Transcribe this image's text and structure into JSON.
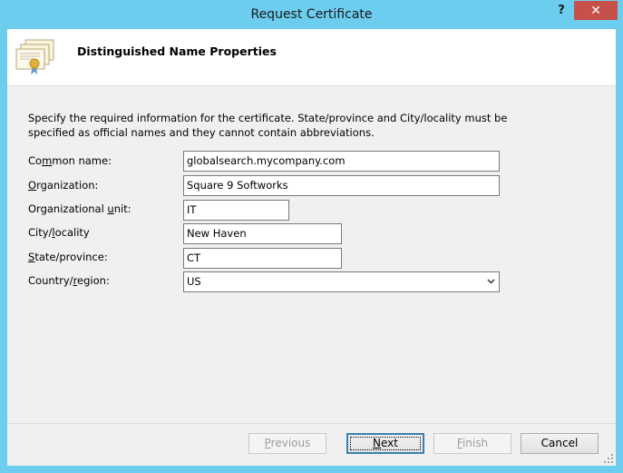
{
  "window": {
    "title": "Request Certificate"
  },
  "titlebar": {
    "help_glyph": "?",
    "close_glyph": "✕"
  },
  "header": {
    "title": "Distinguished Name Properties",
    "icon": "certificate-icon"
  },
  "instructions": "Specify the required information for the certificate. State/province and City/locality must be specified as official names and they cannot contain abbreviations.",
  "form": {
    "common_name": {
      "label_pre": "Co",
      "label_acc": "m",
      "label_post": "mon name:",
      "value": "globalsearch.mycompany.com"
    },
    "organization": {
      "label_pre": "",
      "label_acc": "O",
      "label_post": "rganization:",
      "value": "Square 9 Softworks"
    },
    "org_unit": {
      "label_pre": "Organizational ",
      "label_acc": "u",
      "label_post": "nit:",
      "value": "IT"
    },
    "city": {
      "label_pre": "City/",
      "label_acc": "l",
      "label_post": "ocality",
      "value": "New Haven"
    },
    "state": {
      "label_pre": "",
      "label_acc": "S",
      "label_post": "tate/province:",
      "value": "CT"
    },
    "country": {
      "label_pre": "Country/",
      "label_acc": "r",
      "label_post": "egion:",
      "value": "US"
    }
  },
  "buttons": {
    "previous": {
      "pre": "",
      "acc": "P",
      "post": "revious"
    },
    "next": {
      "pre": "",
      "acc": "N",
      "post": "ext"
    },
    "finish": {
      "pre": "",
      "acc": "F",
      "post": "inish"
    },
    "cancel": "Cancel"
  },
  "colors": {
    "titlebar": "#6ccdef",
    "close": "#c7504a",
    "dialog_bg": "#f0f0f0"
  }
}
